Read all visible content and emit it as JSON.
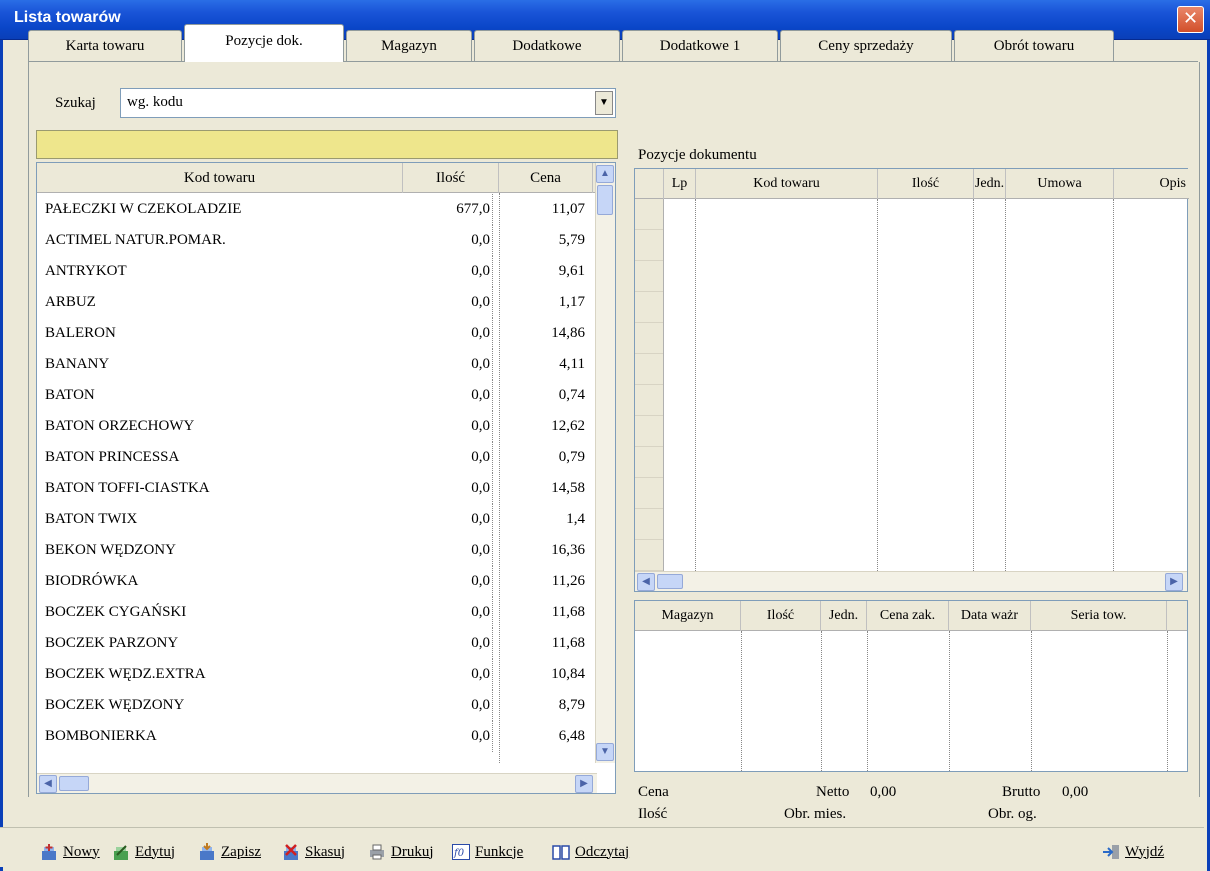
{
  "window": {
    "title": "Lista towarów",
    "close_glyph": "✕"
  },
  "tabs": [
    {
      "label": "Karta towaru"
    },
    {
      "label": "Pozycje dok."
    },
    {
      "label": "Magazyn"
    },
    {
      "label": "Dodatkowe"
    },
    {
      "label": "Dodatkowe 1"
    },
    {
      "label": "Ceny sprzedaży"
    },
    {
      "label": "Obrót towaru"
    }
  ],
  "search": {
    "label": "Szukaj",
    "selected": "wg. kodu",
    "input_value": ""
  },
  "products": {
    "headers": [
      "Kod towaru",
      "Ilość",
      "Cena"
    ],
    "rows": [
      [
        "PAŁECZKI W CZEKOLADZIE",
        "677,0",
        "11,07"
      ],
      [
        "ACTIMEL NATUR.POMAR.",
        "0,0",
        "5,79"
      ],
      [
        "ANTRYKOT",
        "0,0",
        "9,61"
      ],
      [
        "ARBUZ",
        "0,0",
        "1,17"
      ],
      [
        "BALERON",
        "0,0",
        "14,86"
      ],
      [
        "BANANY",
        "0,0",
        "4,11"
      ],
      [
        "BATON",
        "0,0",
        "0,74"
      ],
      [
        "BATON  ORZECHOWY",
        "0,0",
        "12,62"
      ],
      [
        "BATON PRINCESSA",
        "0,0",
        "0,79"
      ],
      [
        "BATON TOFFI-CIASTKA",
        "0,0",
        "14,58"
      ],
      [
        "BATON TWIX",
        "0,0",
        "1,4"
      ],
      [
        "BEKON WĘDZONY",
        "0,0",
        "16,36"
      ],
      [
        "BIODRÓWKA",
        "0,0",
        "11,26"
      ],
      [
        "BOCZEK CYGAŃSKI",
        "0,0",
        "11,68"
      ],
      [
        "BOCZEK PARZONY",
        "0,0",
        "11,68"
      ],
      [
        "BOCZEK WĘDZ.EXTRA",
        "0,0",
        "10,84"
      ],
      [
        "BOCZEK WĘDZONY",
        "0,0",
        "8,79"
      ],
      [
        "BOMBONIERKA",
        "0,0",
        "6,48"
      ]
    ]
  },
  "document_positions": {
    "label": "Pozycje dokumentu",
    "headers": [
      "Lp",
      "Kod towaru",
      "Ilość",
      "Jedn.",
      "Umowa",
      "Opis"
    ]
  },
  "stock": {
    "headers": [
      "Magazyn",
      "Ilość",
      "Jedn.",
      "Cena zak.",
      "Data ważr",
      "Seria tow."
    ]
  },
  "summary": {
    "cena_label": "Cena",
    "netto_label": "Netto",
    "netto_value": "0,00",
    "brutto_label": "Brutto",
    "brutto_value": "0,00",
    "ilosc_label": "Ilość",
    "obr_mies_label": "Obr. mies.",
    "obr_og_label": "Obr. og."
  },
  "toolbar": {
    "nowy": "Nowy",
    "edytuj": "Edytuj",
    "zapisz": "Zapisz",
    "skasuj": "Skasuj",
    "drukuj": "Drukuj",
    "funkcje": "Funkcje",
    "odczytaj": "Odczytaj",
    "wyjdz": "Wyjdź"
  },
  "colors": {
    "titlebar": "#0a46c8",
    "yellow_field": "#eee68c",
    "panel": "#ece9d8"
  }
}
